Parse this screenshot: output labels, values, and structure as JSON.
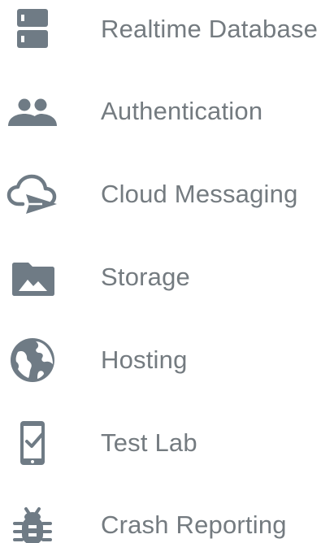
{
  "theme": {
    "icon_color": "#6f7b85",
    "text_color": "#747b80",
    "background": "#ffffff"
  },
  "menu": {
    "items": [
      {
        "label": "Realtime Database",
        "icon": "database-icon"
      },
      {
        "label": "Authentication",
        "icon": "people-icon"
      },
      {
        "label": "Cloud Messaging",
        "icon": "cloud-send-icon"
      },
      {
        "label": "Storage",
        "icon": "folder-image-icon"
      },
      {
        "label": "Hosting",
        "icon": "globe-icon"
      },
      {
        "label": "Test Lab",
        "icon": "phone-check-icon"
      },
      {
        "label": "Crash Reporting",
        "icon": "bug-icon"
      }
    ]
  }
}
